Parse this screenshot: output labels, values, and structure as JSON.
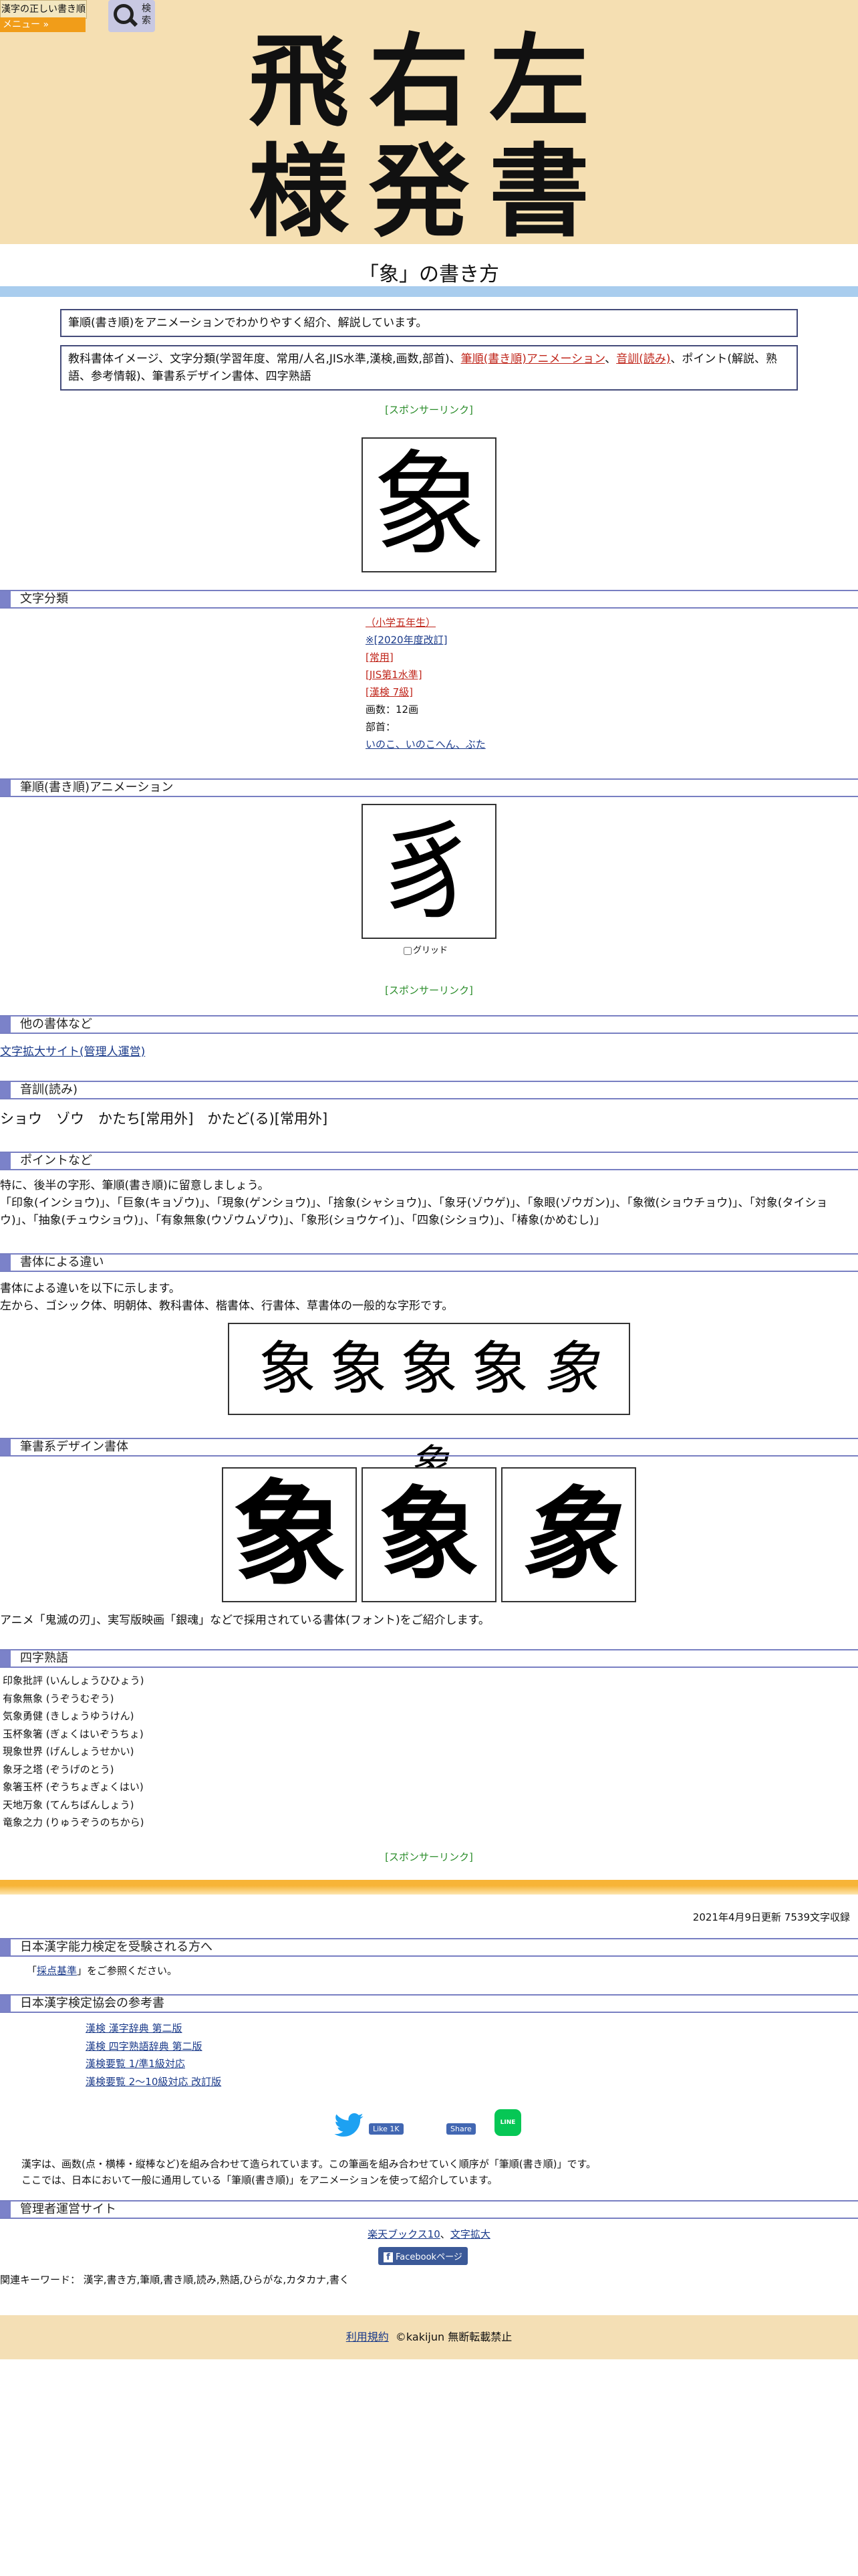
{
  "header": {
    "logo_small": "漢字の正しい書き順(筆順)",
    "menu_label": "メニュー »",
    "search_label": "検索",
    "hero_title": "飛右左\n様発書"
  },
  "page_title": "「象」の書き方",
  "intro": {
    "line1": "筆順(書き順)をアニメーションでわかりやすく紹介、解説しています。",
    "line2_a": "教科書体イメージ、文字分類(学習年度、常用/人名,JIS水準,漢検,画数,部首)、",
    "line2_red": "筆順(書き順)アニメーション",
    "line2_b": "、",
    "line2_red2": "音訓(読み)",
    "line2_c": "、ポイント(解説、熟語、参考情報)、筆書系デザイン書体、四字熟語"
  },
  "sponsor_label": "[スポンサーリンク]",
  "main_char": "象",
  "sections": {
    "classification": "文字分類",
    "animation": "筆順(書き順)アニメーション",
    "other_fonts": "他の書体など",
    "reading": "音訓(読み)",
    "points": "ポイントなど",
    "font_diff": "書体による違い",
    "brush_design": "筆書系デザイン書体",
    "yoji": "四字熟語",
    "kentei": "日本漢字能力検定を受験される方へ",
    "kentei_ref": "日本漢字検定協会の参考書",
    "admin": "管理者運営サイト"
  },
  "classification": {
    "grade": "（小学五年生）",
    "revision": "※[2020年度改訂]",
    "joyo": "[常用]",
    "jis": "[JIS第1水準]",
    "kanken": "[漢検 7級]",
    "strokes": "画数：12画",
    "radical_label": "部首：",
    "radical": "いのこ、いのこへん、ぶた"
  },
  "animation": {
    "partial_char": "豸",
    "grid_label": "グリッド"
  },
  "other_fonts_link": "文字拡大サイト(管理人運営)",
  "reading_text": "ショウ　ゾウ　かたち[常用外]　かたど(る)[常用外]",
  "points_text": "特に、後半の字形、筆順(書き順)に留意しましょう。\n「印象(インショウ)」、「巨象(キョゾウ)」、「現象(ゲンショウ)」、「捨象(シャショウ)」、「象牙(ゾウゲ)」、「象眼(ゾウガン)」、「象徴(ショウチョウ)」、「対象(タイショウ)」、「抽象(チュウショウ)」、「有象無象(ウゾウムゾウ)」、「象形(ショウケイ)」、「四象(シショウ)」、「椿象(かめむし)」",
  "font_diff_text1": "書体による違いを以下に示します。",
  "font_diff_text2": "左から、ゴシック体、明朝体、教科書体、楷書体、行書体、草書体の一般的な字形です。",
  "font_samples": [
    "象",
    "象",
    "象",
    "象",
    "象",
    "象"
  ],
  "brush_samples": [
    "象",
    "象",
    "象"
  ],
  "brush_caption": "アニメ「鬼滅の刃」、実写版映画「銀魂」などで採用されている書体(フォント)をご紹介します。",
  "yoji_list": [
    "印象批評 (いんしょうひひょう)",
    "有象無象 (うぞうむぞう)",
    "気象勇健 (きしょうゆうけん)",
    "玉杯象箸 (ぎょくはいぞうちょ)",
    "現象世界 (げんしょうせかい)",
    "象牙之塔 (ぞうげのとう)",
    "象箸玉杯 (ぞうちょぎょくはい)",
    "天地万象 (てんちばんしょう)",
    "竜象之力 (りゅうぞうのちから)"
  ],
  "updated": "2021年4月9日更新 7539文字収録",
  "kentei": {
    "text_a": "「",
    "link": "採点基準",
    "text_b": "」をご参照ください。"
  },
  "ref_books": [
    "漢検 漢字辞典 第二版",
    "漢検 四字熟語辞典 第二版",
    "漢検要覧 1/準1級対応",
    "漢検要覧 2～10級対応 改訂版"
  ],
  "share": {
    "like": "Like 1K",
    "share": "Share",
    "line": "LINE"
  },
  "notice1": "漢字は、画数(点・横棒・縦棒など)を組み合わせて造られています。この筆画を組み合わせていく順序が「筆順(書き順)」です。",
  "notice2": "ここでは、日本において一般に通用している「筆順(書き順)」をアニメーションを使って紹介しています。",
  "admin_links": [
    "楽天ブックス10",
    "文字拡大"
  ],
  "facebook_label": "Facebookページ",
  "keywords": "関連キーワード： 漢字,書き方,筆順,書き順,読み,熟語,ひらがな,カタカナ,書く",
  "footer": {
    "terms": "利用規約",
    "copyright": "©kakijun 無断転載禁止"
  },
  "colors": {
    "accent_orange": "#f7b437",
    "section_bar": "#7b82c9",
    "hero_bg": "#f5dfb2"
  }
}
